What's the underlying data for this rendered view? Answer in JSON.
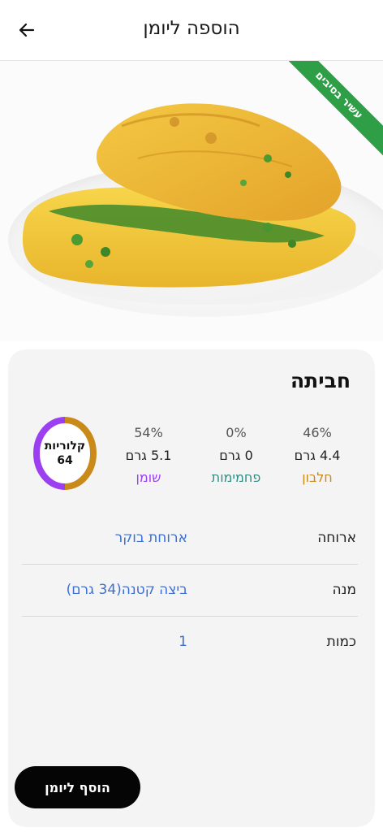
{
  "header": {
    "title": "הוספה ליומן",
    "back_icon": "arrow-left-icon"
  },
  "hero": {
    "image": "omelette-photo",
    "badge": "עשיר בסיבים",
    "badge_color": "#2e9e47"
  },
  "food": {
    "name": "חביתה"
  },
  "macros": [
    {
      "name": "חלבון",
      "amount": "4.4 גרם",
      "percent": "46%",
      "color": "#c98a1a"
    },
    {
      "name": "פחמימות",
      "amount": "0 גרם",
      "percent": "0%",
      "color": "#2f8f86"
    },
    {
      "name": "שומן",
      "amount": "5.1 גרם",
      "percent": "54%",
      "color": "#9b3ff0"
    }
  ],
  "calories": {
    "label": "קלוריות",
    "value": "64",
    "ring_split": {
      "protein_pct": 46,
      "fat_pct": 54
    }
  },
  "details": [
    {
      "label": "ארוחה",
      "value": "ארוחת בוקר"
    },
    {
      "label": "מנה",
      "value": "ביצה קטנה(34 גרם)"
    },
    {
      "label": "כמות",
      "value": "1"
    }
  ],
  "actions": {
    "add_label": "הוסף ליומן"
  }
}
